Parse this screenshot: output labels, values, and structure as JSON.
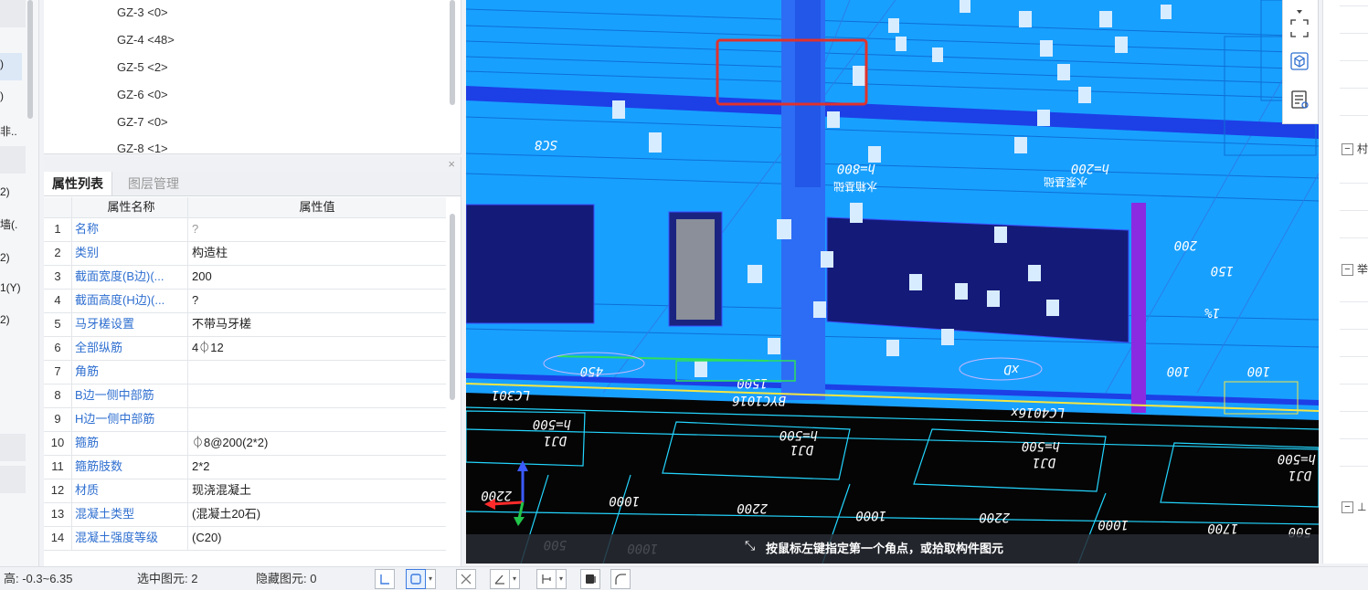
{
  "left_strip": {
    "items": [
      ")",
      ")",
      "非..",
      "2)",
      "墙(.",
      "2)",
      "1(Y)",
      "2)"
    ]
  },
  "tree": {
    "items": [
      "GZ-3 <0>",
      "GZ-4 <48>",
      "GZ-5 <2>",
      "GZ-6 <0>",
      "GZ-7 <0>",
      "GZ-8 <1>"
    ]
  },
  "properties": {
    "close_label": "×",
    "tabs": [
      {
        "label": "属性列表",
        "active": true
      },
      {
        "label": "图层管理",
        "active": false
      }
    ],
    "header": {
      "name": "属性名称",
      "value": "属性值"
    },
    "rows": [
      {
        "idx": "1",
        "name": "名称",
        "value": "?"
      },
      {
        "idx": "2",
        "name": "类别",
        "value": "构造柱"
      },
      {
        "idx": "3",
        "name": "截面宽度(B边)(...",
        "value": "200"
      },
      {
        "idx": "4",
        "name": "截面高度(H边)(...",
        "value": "?"
      },
      {
        "idx": "5",
        "name": "马牙槎设置",
        "value": "不带马牙槎"
      },
      {
        "idx": "6",
        "name": "全部纵筋",
        "value": "4⏀12"
      },
      {
        "idx": "7",
        "name": "角筋",
        "value": ""
      },
      {
        "idx": "8",
        "name": "B边一侧中部筋",
        "value": ""
      },
      {
        "idx": "9",
        "name": "H边一侧中部筋",
        "value": ""
      },
      {
        "idx": "10",
        "name": "箍筋",
        "value": "⏀8@200(2*2)"
      },
      {
        "idx": "11",
        "name": "箍筋肢数",
        "value": "2*2"
      },
      {
        "idx": "12",
        "name": "材质",
        "value": "现浇混凝土"
      },
      {
        "idx": "13",
        "name": "混凝土类型",
        "value": "(混凝土20石)"
      },
      {
        "idx": "14",
        "name": "混凝土强度等级",
        "value": "(C20)"
      }
    ]
  },
  "viewport": {
    "hint": "按鼠标左键指定第一个角点，或拾取构件图元",
    "drawing_labels": {
      "upper": [
        "h=800",
        "h=200",
        "SC8",
        "150",
        "200",
        "1%",
        "450",
        "1500",
        "xD",
        "100",
        "100"
      ],
      "lower": [
        "LC301",
        "BYC1016",
        "LC4016x",
        "h=500",
        "DJ1",
        "h=500",
        "DJ1",
        "h=500",
        "DJ1",
        "h=500",
        "DJ1",
        "1000",
        "2200",
        "1000",
        "2200",
        "1000",
        "1700",
        "500",
        "1000",
        "500",
        "2200"
      ],
      "upper_text": [
        "水箱基础",
        "水泵基础"
      ]
    },
    "colors": {
      "background": "#18a0ff",
      "dark_zone": "#050505",
      "wall": "#1d3fe6",
      "column": "#2d6df5",
      "highlight": "#e0322c",
      "line": "#23d6ff",
      "purple": "#8a2be2",
      "yellow": "#f5e642"
    }
  },
  "right_strip": {
    "groups": [
      {
        "toggle": "−",
        "label": "村"
      },
      {
        "toggle": "−",
        "label": "举"
      },
      {
        "toggle": "−",
        "label": "⊥"
      }
    ]
  },
  "status": {
    "floor_height": "高:  -0.3~6.35",
    "selected": "选中图元:  2",
    "hidden": "隐藏图元:  0"
  }
}
